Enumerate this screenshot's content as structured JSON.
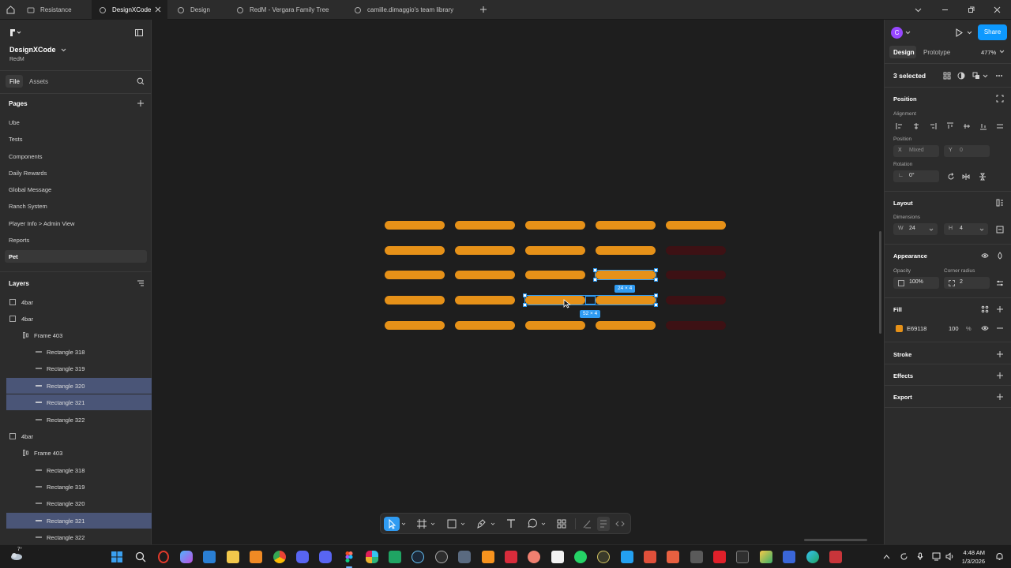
{
  "tabs": [
    {
      "label": "Resistance",
      "active": false
    },
    {
      "label": "DesignXCode",
      "active": true
    },
    {
      "label": "Design",
      "active": false
    },
    {
      "label": "RedM - Vergara Family Tree",
      "active": false
    },
    {
      "label": "camille.dimaggio's team library",
      "active": false
    }
  ],
  "file": {
    "name": "DesignXCode",
    "project": "RedM"
  },
  "left_tabs": {
    "file": "File",
    "assets": "Assets"
  },
  "pages": {
    "title": "Pages",
    "items": [
      "Ube",
      "Tests",
      "Components",
      "Daily Rewards",
      "Global Message",
      "Ranch System",
      "Player Info > Admin View",
      "Reports",
      "Pet"
    ],
    "selected": "Pet"
  },
  "layers": {
    "title": "Layers",
    "items": [
      {
        "name": "4bar",
        "type": "frame",
        "indent": 0,
        "selected": false
      },
      {
        "name": "4bar",
        "type": "frame",
        "indent": 0,
        "selected": false
      },
      {
        "name": "Frame 403",
        "type": "autolayout",
        "indent": 1,
        "selected": false
      },
      {
        "name": "Rectangle 318",
        "type": "line",
        "indent": 2,
        "selected": false
      },
      {
        "name": "Rectangle 319",
        "type": "line",
        "indent": 2,
        "selected": false
      },
      {
        "name": "Rectangle 320",
        "type": "line",
        "indent": 2,
        "selected": true
      },
      {
        "name": "Rectangle 321",
        "type": "line",
        "indent": 2,
        "selected": true
      },
      {
        "name": "Rectangle 322",
        "type": "line",
        "indent": 2,
        "selected": false
      },
      {
        "name": "4bar",
        "type": "frame",
        "indent": 0,
        "selected": false
      },
      {
        "name": "Frame 403",
        "type": "autolayout",
        "indent": 1,
        "selected": false
      },
      {
        "name": "Rectangle 318",
        "type": "line",
        "indent": 2,
        "selected": false
      },
      {
        "name": "Rectangle 319",
        "type": "line",
        "indent": 2,
        "selected": false
      },
      {
        "name": "Rectangle 320",
        "type": "line",
        "indent": 2,
        "selected": false
      },
      {
        "name": "Rectangle 321",
        "type": "line",
        "indent": 2,
        "selected": true
      },
      {
        "name": "Rectangle 322",
        "type": "line",
        "indent": 2,
        "selected": false
      }
    ]
  },
  "canvas": {
    "bar_color": "#E69118",
    "inactive_bar_color": "#3D1114",
    "selection_color": "#2F9BF2",
    "labels": {
      "top_selection": "24 × 4",
      "bottom_selection": "52 × 4"
    }
  },
  "toolbar": {
    "icons": [
      "move-icon",
      "frame-icon",
      "rectangle-icon",
      "pen-icon",
      "text-icon",
      "comment-icon",
      "components-icon",
      "draw-icon",
      "dev-icon",
      "code-icon"
    ]
  },
  "right": {
    "avatar_letter": "C",
    "share": "Share",
    "tabs": {
      "design": "Design",
      "prototype": "Prototype"
    },
    "zoom": "477%",
    "selection": "3 selected",
    "position": {
      "title": "Position",
      "alignment_label": "Alignment",
      "position_label": "Position",
      "x_prefix": "X",
      "x_value": "Mixed",
      "y_prefix": "Y",
      "y_value": "0",
      "rotation_label": "Rotation",
      "rotation_value": "0°"
    },
    "layout": {
      "title": "Layout",
      "dimensions_label": "Dimensions",
      "w_prefix": "W",
      "w_value": "24",
      "h_prefix": "H",
      "h_value": "4"
    },
    "appearance": {
      "title": "Appearance",
      "opacity_label": "Opacity",
      "opacity_value": "100%",
      "radius_label": "Corner radius",
      "radius_value": "2"
    },
    "fill": {
      "title": "Fill",
      "hex": "E69118",
      "opacity": "100",
      "percent": "%",
      "swatch": "#E69118"
    },
    "stroke": "Stroke",
    "effects": "Effects",
    "export": "Export"
  },
  "taskbar": {
    "time": "4:48 AM",
    "date": "1/3/2026",
    "weather_temp": "7°"
  }
}
